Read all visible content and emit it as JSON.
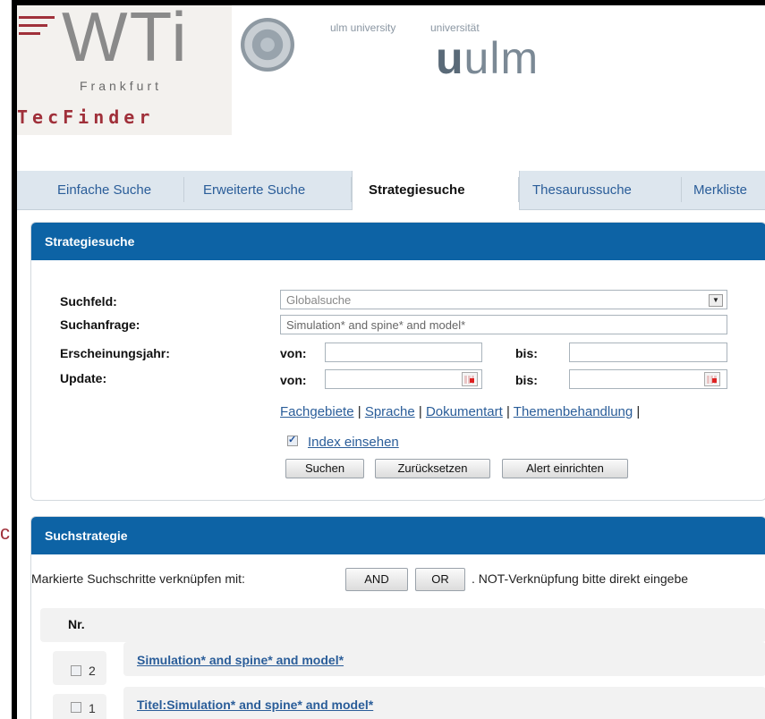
{
  "header": {
    "logo_text": "WTi",
    "logo_subtitle": "Frankfurt",
    "app_name": "TecFinder",
    "ulm_small": "ulm university",
    "uni_small": "universität",
    "uulm_prefix": "u",
    "uulm_rest": "ulm"
  },
  "tabs": [
    {
      "label": "Einfache Suche"
    },
    {
      "label": "Erweiterte Suche"
    },
    {
      "label": "Strategiesuche"
    },
    {
      "label": "Thesaurussuche"
    },
    {
      "label": "Merkliste"
    }
  ],
  "strategy_panel": {
    "title": "Strategiesuche",
    "suchfeld_label": "Suchfeld:",
    "suchfeld_value": "Globalsuche",
    "suchanfrage_label": "Suchanfrage:",
    "suchanfrage_value": "Simulation* and spine* and model*",
    "year_label": "Erscheinungsjahr:",
    "update_label": "Update:",
    "von_label": "von:",
    "bis_label": "bis:",
    "links": [
      "Fachgebiete",
      "Sprache",
      "Dokumentart",
      "Themenbehandlung"
    ],
    "separator": "|",
    "index_label": "Index einsehen",
    "index_checked": true,
    "buttons": {
      "search": "Suchen",
      "reset": "Zurücksetzen",
      "alert": "Alert einrichten"
    }
  },
  "strategy_list": {
    "title": "Suchstrategie",
    "combine_text": "Markierte Suchschritte verknüpfen mit:",
    "and_label": "AND",
    "or_label": "OR",
    "not_text": ". NOT-Verknüpfung bitte direkt eingebe",
    "nr_header": "Nr.",
    "rows": [
      {
        "num": "2",
        "query": "Simulation* and spine* and model*"
      },
      {
        "num": "1",
        "query": "Titel:Simulation* and spine* and model*"
      }
    ]
  },
  "stray_glyph": "c",
  "colors": {
    "header_blue": "#0d63a5",
    "link_blue": "#2a5d99",
    "brand_red": "#a0303a"
  }
}
